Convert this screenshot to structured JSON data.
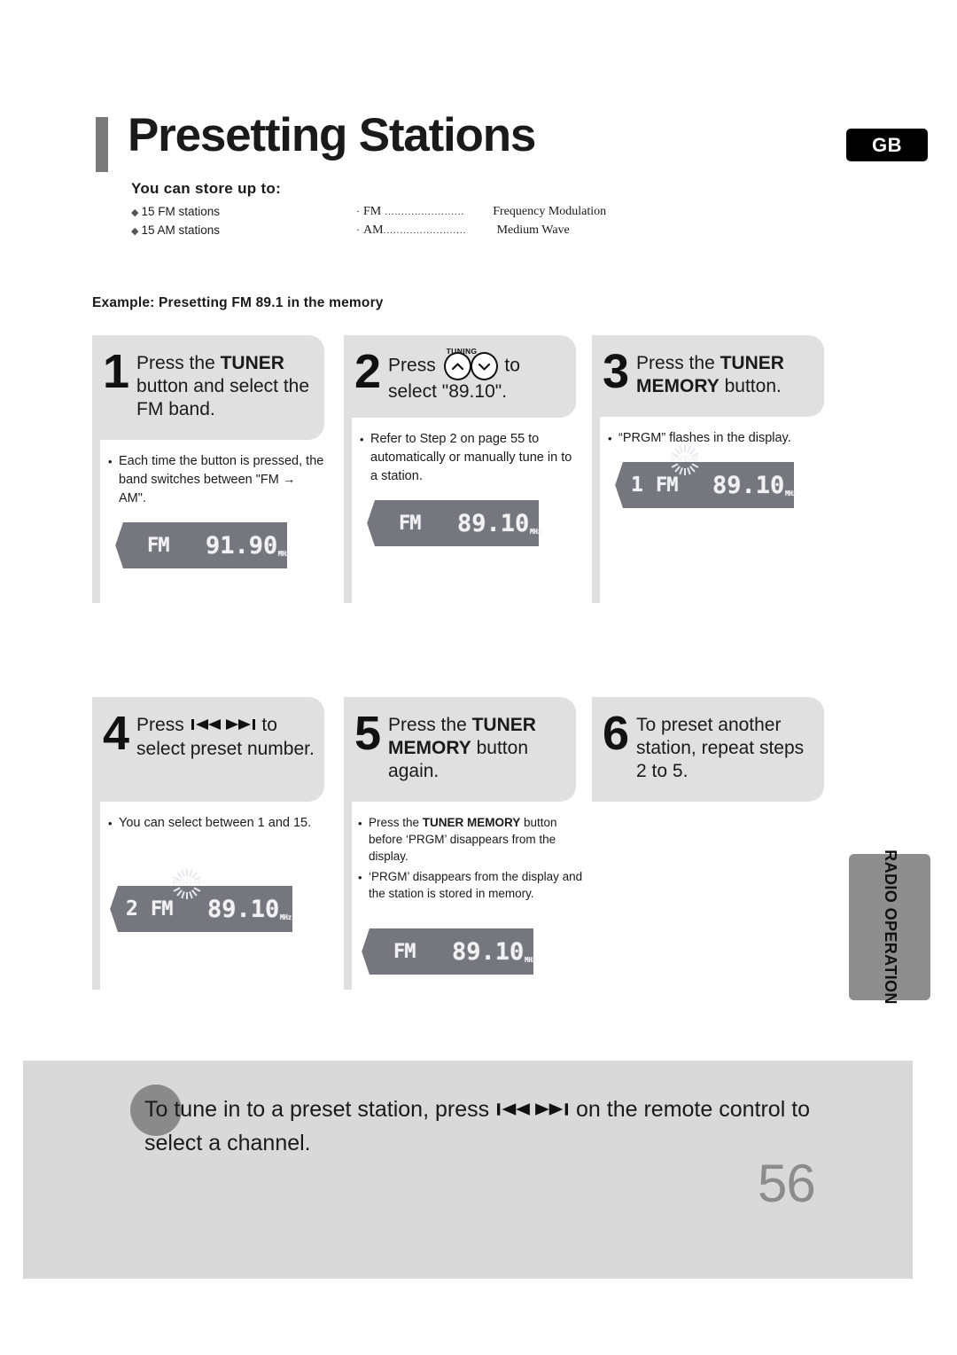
{
  "header": {
    "title": "Presetting Stations",
    "region_badge": "GB"
  },
  "store_info": {
    "heading": "You can store up to:",
    "items": [
      "15 FM stations",
      "15 AM stations"
    ],
    "band_legend": [
      {
        "abbr": "FM",
        "desc": "Frequency Modulation"
      },
      {
        "abbr": "AM",
        "desc": "Medium Wave"
      }
    ]
  },
  "example_line": "Example: Presetting FM 89.1 in the memory",
  "steps": [
    {
      "number": "1",
      "title_parts": [
        {
          "text": "Press the ",
          "bold": false
        },
        {
          "text": "TUNER",
          "bold": true
        },
        {
          "text": " button and select the FM band.",
          "bold": false
        }
      ],
      "notes": [
        "Each time the button is pressed, the band switches between \"FM → AM\"."
      ],
      "display": {
        "preset": "",
        "band": "FM",
        "freq": "91.90",
        "unit": "MHz",
        "prgm": false
      }
    },
    {
      "number": "2",
      "tuning_label": "TUNING",
      "title_pre": "Press ",
      "title_post": " to select \"89.10\".",
      "notes": [
        "Refer to Step 2 on page 55 to automatically or manually tune in to a station."
      ],
      "display": {
        "preset": "",
        "band": "FM",
        "freq": "89.10",
        "unit": "MHz",
        "prgm": false
      }
    },
    {
      "number": "3",
      "title_parts": [
        {
          "text": "Press the ",
          "bold": false
        },
        {
          "text": "TUNER MEMORY",
          "bold": true
        },
        {
          "text": " button.",
          "bold": false
        }
      ],
      "notes": [
        "“PRGM” flashes in the display."
      ],
      "display": {
        "preset": "1",
        "band": "FM",
        "freq": "89.10",
        "unit": "MHz",
        "prgm": true,
        "prgm_text": "PRGM"
      }
    },
    {
      "number": "4",
      "title_pre": "Press ",
      "title_post": " to select preset number.",
      "notes": [
        "You can select between 1 and 15."
      ],
      "display": {
        "preset": "2",
        "band": "FM",
        "freq": "89.10",
        "unit": "MHz",
        "prgm": true,
        "prgm_text": "PRGM"
      }
    },
    {
      "number": "5",
      "title_parts": [
        {
          "text": "Press the ",
          "bold": false
        },
        {
          "text": "TUNER MEMORY",
          "bold": true
        },
        {
          "text": " button again.",
          "bold": false
        }
      ],
      "notes": [
        "Press the TUNER MEMORY button before ‘PRGM’ disappears from the display.",
        "‘PRGM’ disappears from the display and the station is stored in memory."
      ],
      "display": {
        "preset": "",
        "band": "FM",
        "freq": "89.10",
        "unit": "MHz",
        "prgm": false
      }
    },
    {
      "number": "6",
      "title_parts": [
        {
          "text": "To preset another station, repeat steps 2 to 5.",
          "bold": false
        }
      ],
      "notes": [],
      "display": null
    }
  ],
  "step1": {
    "num": "1",
    "t_pre": "Press the ",
    "t_bold": "TUNER",
    "t_post": " button and select the FM band.",
    "note1": "Each time the button is pressed, the band switches between \"FM → AM\".",
    "lcd_band": "FM",
    "lcd_freq": "91.90",
    "lcd_unit": "MHz"
  },
  "step2": {
    "num": "2",
    "tuning_label": "TUNING",
    "t_pre": "Press ",
    "t_post": " to select \"89.10\".",
    "note1": "Refer to Step 2 on page 55 to automatically or manually tune in to a station.",
    "lcd_band": "FM",
    "lcd_freq": "89.10",
    "lcd_unit": "MHz"
  },
  "step3": {
    "num": "3",
    "t_pre": "Press the ",
    "t_bold": "TUNER MEMORY",
    "t_post": " button.",
    "note1": "“PRGM” flashes in the display.",
    "lcd_preset": "1",
    "lcd_band": "FM",
    "lcd_freq": "89.10",
    "lcd_unit": "MHz",
    "lcd_prgm": "PRGM"
  },
  "step4": {
    "num": "4",
    "t_pre": "Press ",
    "t_post": " to select preset number.",
    "note1": "You can select between 1 and 15.",
    "lcd_preset": "2",
    "lcd_band": "FM",
    "lcd_freq": "89.10",
    "lcd_unit": "MHz",
    "lcd_prgm": "PRGM"
  },
  "step5": {
    "num": "5",
    "t_pre": "Press the ",
    "t_bold": "TUNER MEMORY",
    "t_post": " button again.",
    "note1_pre": "Press the ",
    "note1_bold": "TUNER MEMORY",
    "note1_post": " button before ‘PRGM’ disappears from the display.",
    "note2": "‘PRGM’ disappears from the display and the station is stored in memory.",
    "lcd_band": "FM",
    "lcd_freq": "89.10",
    "lcd_unit": "MHz"
  },
  "step6": {
    "num": "6",
    "t_full": "To preset another station, repeat steps 2 to 5."
  },
  "side_tab": {
    "label": "RADIO OPERATION"
  },
  "bottom_note": {
    "pre": "To tune in to a preset station, press ",
    "post": " on the remote control to select a channel.",
    "page_number": "56"
  },
  "colors": {
    "step_box": "#e0e0e0",
    "lcd_bg": "#76767e",
    "side_tab": "#8e8e8e",
    "bottom_box": "#d9d9d9",
    "page_number": "#8c8c8c",
    "title_bar": "#7a7a7a"
  }
}
